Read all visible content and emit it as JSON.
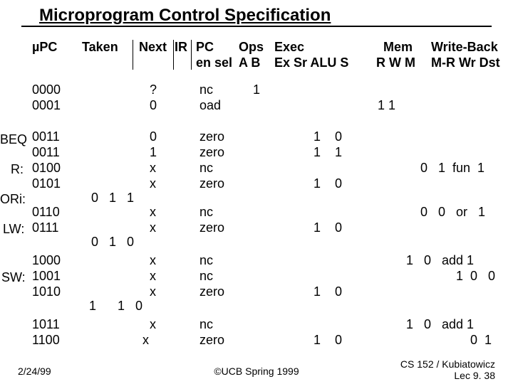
{
  "title": "Microprogram Control Specification",
  "header": {
    "upc": "µPC",
    "taken": "Taken",
    "next": "Next",
    "ir": "IR",
    "pc": "PC",
    "ops": "Ops",
    "exec": "Exec",
    "mem": "Mem",
    "wb": "Write-Back",
    "sub_pc": "en sel",
    "sub_ops": "A B",
    "sub_exec": "Ex Sr ALU S",
    "sub_mem": "R W M",
    "sub_wb": "M-R Wr Dst"
  },
  "labels": {
    "beq": "BEQ",
    "r": "R:",
    "ori": "ORi:",
    "lw": "LW:",
    "sw": "SW:"
  },
  "rows": {
    "r0": {
      "upc": "0000",
      "next": "?",
      "pc": "nc",
      "ops": "1"
    },
    "r1": {
      "upc": "0001",
      "next": "0",
      "pc": "oad",
      "mem": "1 1"
    },
    "r2": {
      "upc": "0011",
      "next": "0",
      "pc": "zero",
      "exec": "1    0"
    },
    "r3": {
      "upc": "0011",
      "next": "1",
      "pc": "zero",
      "exec": "1    1"
    },
    "r4": {
      "upc": "0100",
      "next": "x",
      "pc": "nc",
      "wb": "0   1  fun  1"
    },
    "r5": {
      "upc": "0101",
      "next": "x",
      "pc": "zero",
      "exec": "1    0"
    },
    "r6g": {
      "taken": "0   1   1"
    },
    "r6": {
      "upc": "0110",
      "next": "x",
      "pc": "nc",
      "wb": "0   0   or   1"
    },
    "r7": {
      "upc": "0111",
      "next": "x",
      "pc": "zero",
      "exec": "1    0"
    },
    "r7g": {
      "taken": "0   1   0"
    },
    "r8": {
      "upc": "1000",
      "next": "x",
      "pc": "nc",
      "mem": "1   0   add 1"
    },
    "r9": {
      "upc": "1001",
      "next": "x",
      "pc": "nc",
      "wb": "1  0   0"
    },
    "r10": {
      "upc": "1010",
      "next": "x",
      "pc": "zero",
      "exec": "1    0"
    },
    "r10g": {
      "taken": "1      1   0"
    },
    "r11": {
      "upc": "1011",
      "next": "x",
      "pc": "nc",
      "mem": "1   0   add 1"
    },
    "r12": {
      "upc": "1100",
      "next": "x",
      "pc": "zero",
      "exec": "1    0",
      "wb": "0  1"
    }
  },
  "footer": {
    "left": "2/24/99",
    "center": "©UCB Spring 1999",
    "right1": "CS 152 / Kubiatowicz",
    "right2": "Lec 9. 38"
  }
}
